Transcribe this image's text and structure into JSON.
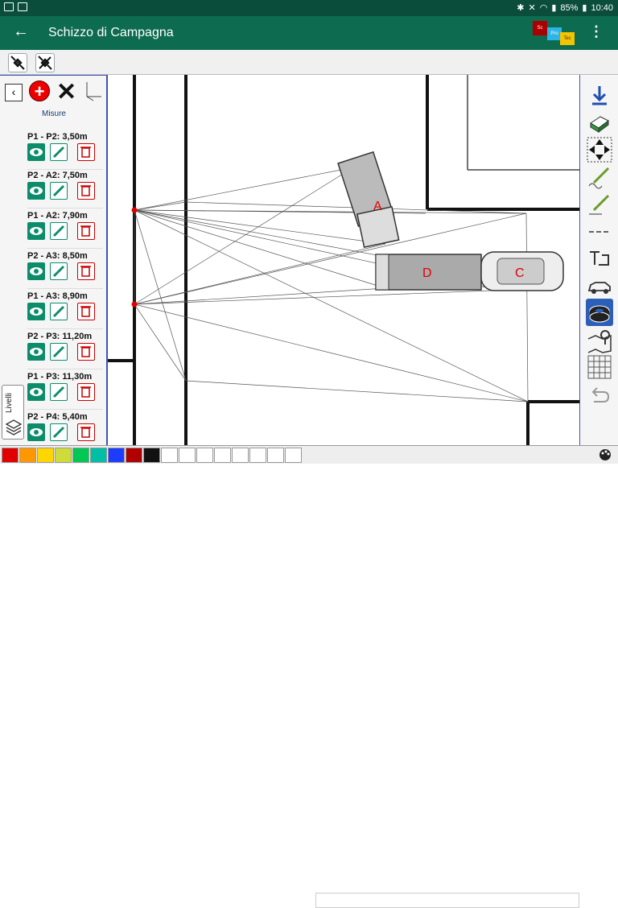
{
  "status_bar": {
    "battery": "85%",
    "time": "10:40"
  },
  "app_bar": {
    "title": "Schizzo di Campagna",
    "brand_tags": [
      "Sc",
      "Pro",
      "Tec"
    ]
  },
  "left_panel": {
    "title": "Misure",
    "measurements": [
      {
        "label": "P1 - P2:",
        "value": "3,50m"
      },
      {
        "label": "P2 - A2:",
        "value": "7,50m"
      },
      {
        "label": "P1 - A2:",
        "value": "7,90m"
      },
      {
        "label": "P2 - A3:",
        "value": "8,50m"
      },
      {
        "label": "P1 - A3:",
        "value": "8,90m"
      },
      {
        "label": "P2 - P3:",
        "value": "11,20m"
      },
      {
        "label": "P1 - P3:",
        "value": "11,30m"
      },
      {
        "label": "P2 - P4:",
        "value": "5,40m"
      }
    ],
    "layers_label": "Livelli"
  },
  "sketch": {
    "vehicle_labels": [
      "A",
      "D",
      "C"
    ]
  },
  "right_tools": [
    "download-icon",
    "eraser-icon",
    "move-icon",
    "freehand-pen-icon",
    "line-pen-icon",
    "dashed-line-icon",
    "text-tool-icon",
    "car-icon",
    "tyre-icon",
    "map-pin-icon",
    "grid-icon",
    "undo-icon"
  ],
  "colors": [
    "#e00000",
    "#ff9800",
    "#ffd600",
    "#cddc39",
    "#00c853",
    "#00bfa5",
    "#00e5ff",
    "#1e3cff",
    "#b00000",
    "#111111",
    "#ffffff",
    "#ffffff",
    "#ffffff",
    "#ffffff",
    "#ffffff",
    "#ffffff",
    "#ffffff",
    "#ffffff"
  ]
}
